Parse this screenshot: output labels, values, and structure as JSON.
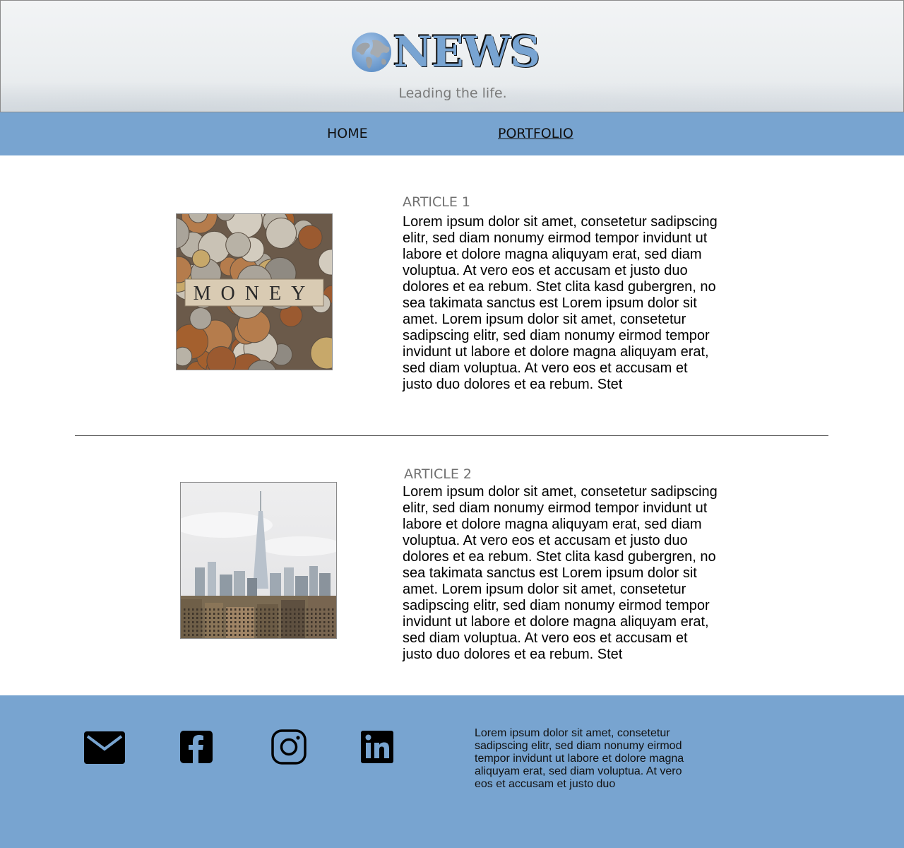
{
  "header": {
    "logo_text": "NEWS",
    "tagline": "Leading the life."
  },
  "nav": {
    "items": [
      {
        "label": "HOME"
      },
      {
        "label": "PORTFOLIO"
      }
    ]
  },
  "articles": [
    {
      "title": "ARTICLE 1",
      "image_text": "MONEY",
      "body": "Lorem ipsum dolor sit amet, consetetur sadipscing elitr, sed diam nonumy eirmod tempor invidunt ut labore et dolore magna aliquyam erat, sed diam voluptua. At vero eos et accusam et justo duo dolores et ea rebum. Stet clita kasd gubergren, no sea takimata sanctus est Lorem ipsum dolor sit amet. Lorem ipsum dolor sit amet, consetetur sadipscing elitr, sed diam nonumy eirmod tempor invidunt ut labore et dolore magna aliquyam erat, sed diam voluptua. At vero eos et accusam et justo duo dolores et ea rebum. Stet"
    },
    {
      "title": "ARTICLE 2",
      "body": "Lorem ipsum dolor sit amet, consetetur sadipscing elitr, sed diam nonumy eirmod tempor invidunt ut labore et dolore magna aliquyam erat, sed diam voluptua. At vero eos et accusam et justo duo dolores et ea rebum. Stet clita kasd gubergren, no sea takimata sanctus est Lorem ipsum dolor sit amet. Lorem ipsum dolor sit amet, consetetur sadipscing elitr, sed diam nonumy eirmod tempor invidunt ut labore et dolore magna aliquyam erat, sed diam voluptua. At vero eos et accusam et justo duo dolores et ea rebum. Stet"
    }
  ],
  "footer": {
    "social_icons": [
      "mail-icon",
      "facebook-icon",
      "instagram-icon",
      "linkedin-icon"
    ],
    "text": "Lorem ipsum dolor sit amet, consetetur sadipscing elitr, sed diam nonumy eirmod tempor invidunt ut labore et dolore magna aliquyam erat, sed diam voluptua. At vero eos et accusam et justo duo"
  },
  "colors": {
    "accent": "#78a4d0",
    "title_gray": "#707070"
  }
}
